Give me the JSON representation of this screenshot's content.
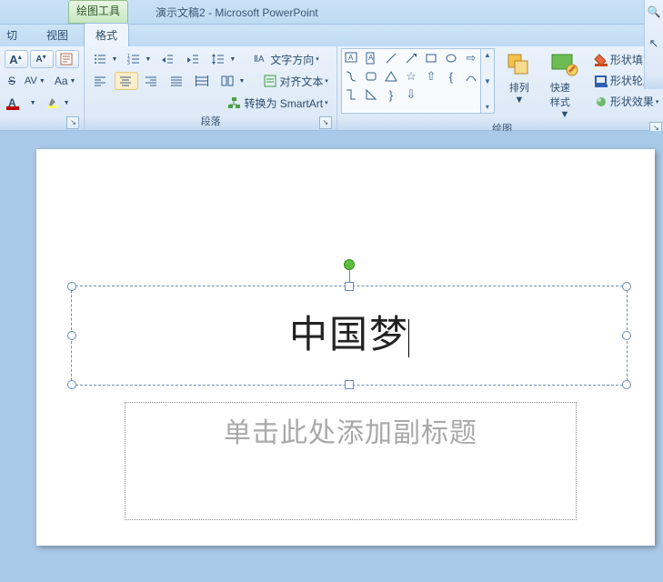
{
  "titlebar": {
    "context_tab": "绘图工具",
    "doc": "演示文稿2",
    "app": "Microsoft PowerPoint"
  },
  "tabs": {
    "t1": "视图",
    "t2": "格式",
    "t_cut": "切"
  },
  "font_group": {
    "inc": "A",
    "dec": "A",
    "strike": "S",
    "spacing": "AV",
    "caps": "Aa",
    "color": "A"
  },
  "paragraph_group": {
    "label": "段落",
    "textdir": "文字方向",
    "align": "对齐文本",
    "smartart": "转换为 SmartArt"
  },
  "drawing_group": {
    "label": "绘图",
    "arrange": "排列",
    "quickstyles": "快速样式",
    "fill": "形状填充",
    "outline": "形状轮廓",
    "effects": "形状效果"
  },
  "slide": {
    "title": "中国梦",
    "subtitle_placeholder": "单击此处添加副标题"
  }
}
